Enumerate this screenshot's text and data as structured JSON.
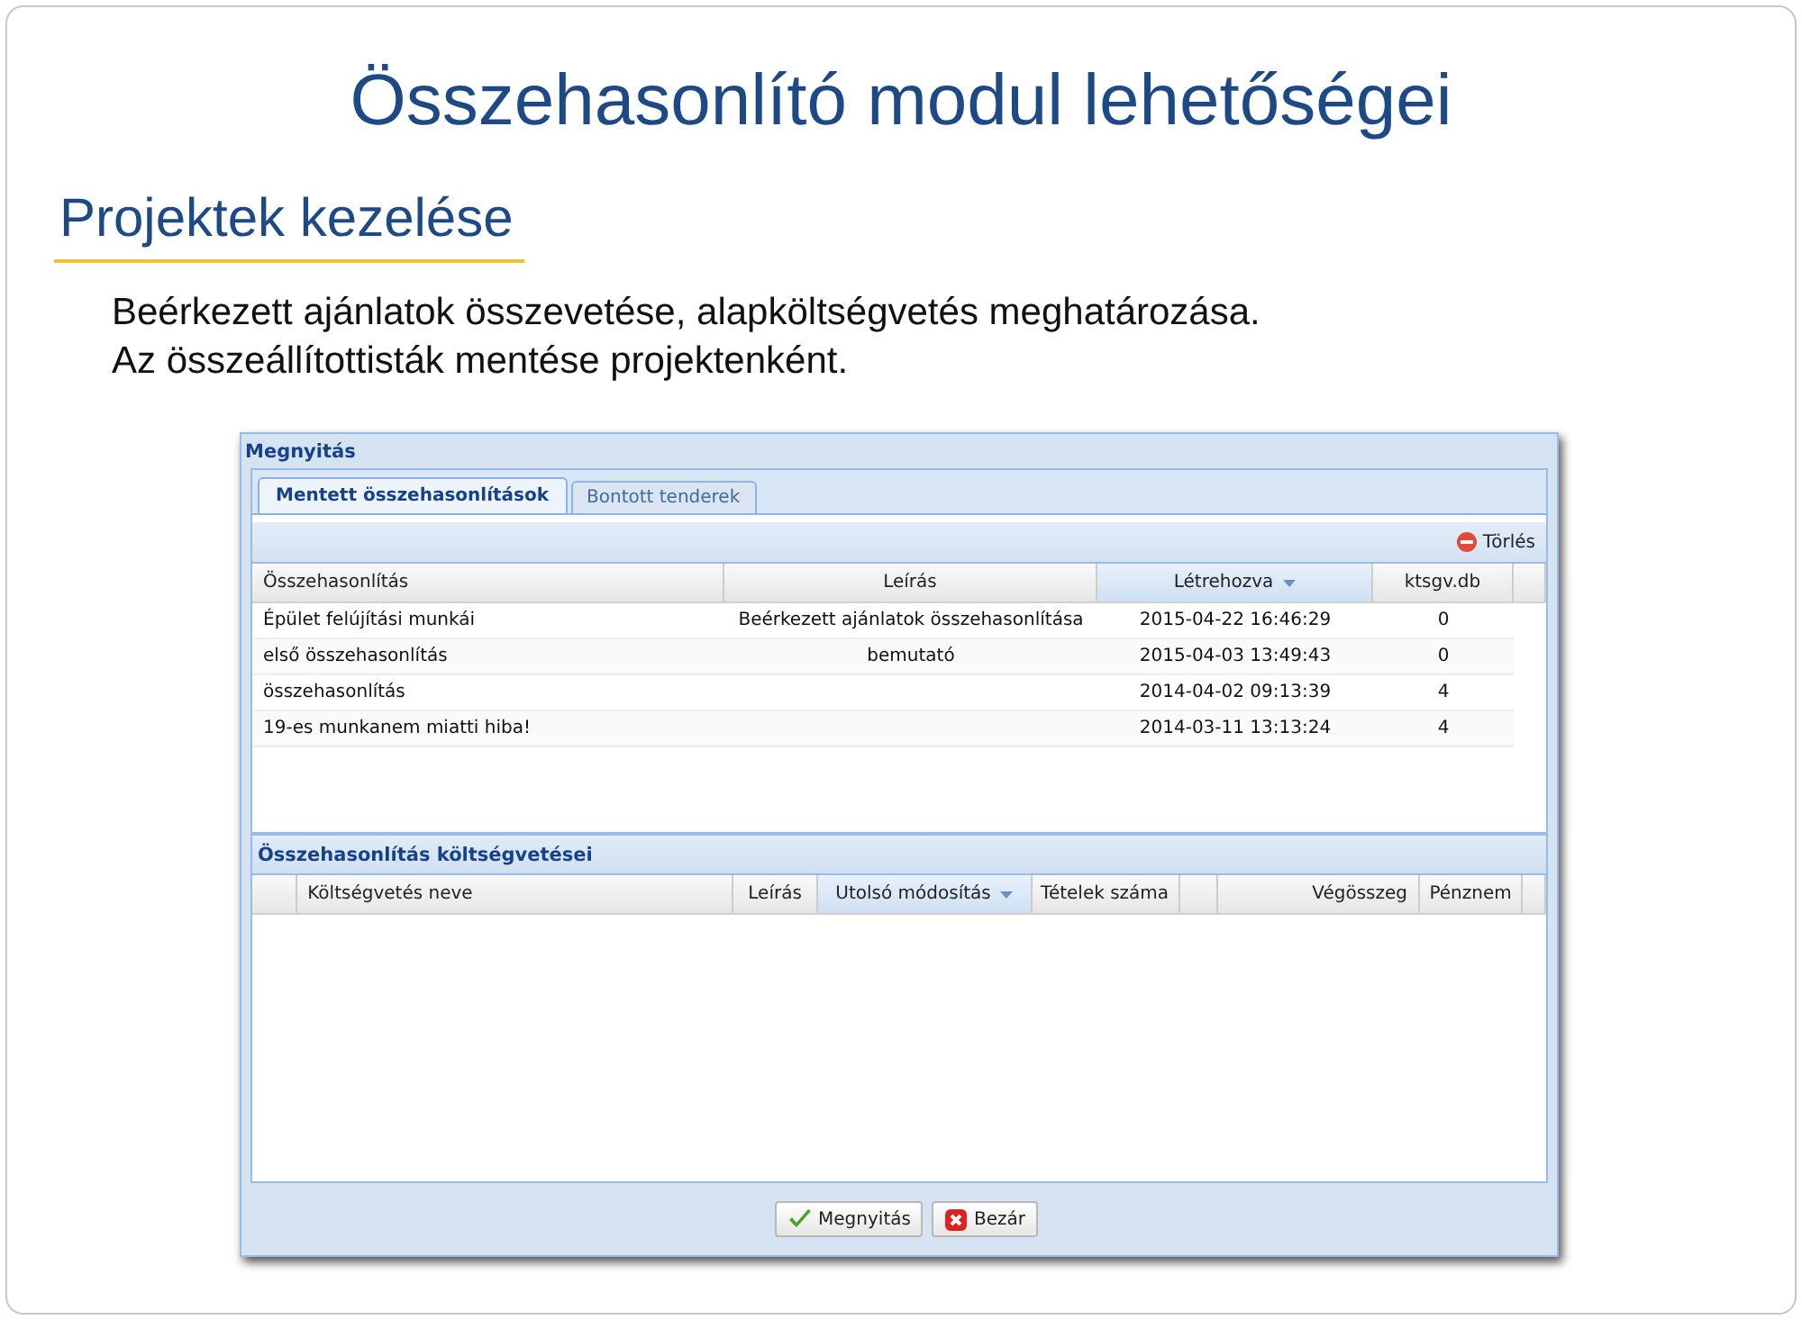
{
  "slide": {
    "title": "Összehasonlító modul lehetőségei",
    "subtitle": "Projektek kezelése",
    "body": [
      "Beérkezett ajánlatok összevetése, alapköltségvetés meghatározása.",
      "Az összeállítottisták mentése projektenként."
    ]
  },
  "window": {
    "title": "Megnyitás",
    "tabs": [
      {
        "label": "Mentett összehasonlítások",
        "selected": true
      },
      {
        "label": "Bontott tenderek",
        "selected": false
      }
    ],
    "toolbar": {
      "delete_button": "Törlés"
    },
    "comparisons": {
      "columns": [
        {
          "label": "Összehasonlítás",
          "sorted": false
        },
        {
          "label": "Leírás",
          "sorted": false
        },
        {
          "label": "Létrehozva",
          "sorted": true
        },
        {
          "label": "ktsgv.db",
          "sorted": false
        }
      ],
      "rows": [
        [
          "Épület felújítási munkái",
          "Beérkezett ajánlatok összehasonlítása",
          "2015-04-22 16:46:29",
          "0"
        ],
        [
          "első összehasonlítás",
          "bemutató",
          "2015-04-03 13:49:43",
          "0"
        ],
        [
          "összehasonlítás",
          "",
          "2014-04-02 09:13:39",
          "4"
        ],
        [
          "19-es munkanem miatti hiba!",
          "",
          "2014-03-11 13:13:24",
          "4"
        ]
      ]
    },
    "budgets": {
      "title": "Összehasonlítás költségvetései",
      "columns": [
        {
          "sorted": false
        },
        {
          "label": "Költségvetés neve",
          "sorted": false
        },
        {
          "label": "Leírás",
          "sorted": false
        },
        {
          "label": "Utolsó módosítás",
          "sorted": true
        },
        {
          "label": "Tételek száma",
          "sorted": false
        },
        {
          "sorted": false
        },
        {
          "label": "Végösszeg",
          "sorted": false
        },
        {
          "label": "Pénznem",
          "sorted": false
        }
      ]
    },
    "buttons": [
      {
        "kind": "open",
        "label": "Megnyitás"
      },
      {
        "kind": "close",
        "label": "Bezár"
      }
    ]
  }
}
